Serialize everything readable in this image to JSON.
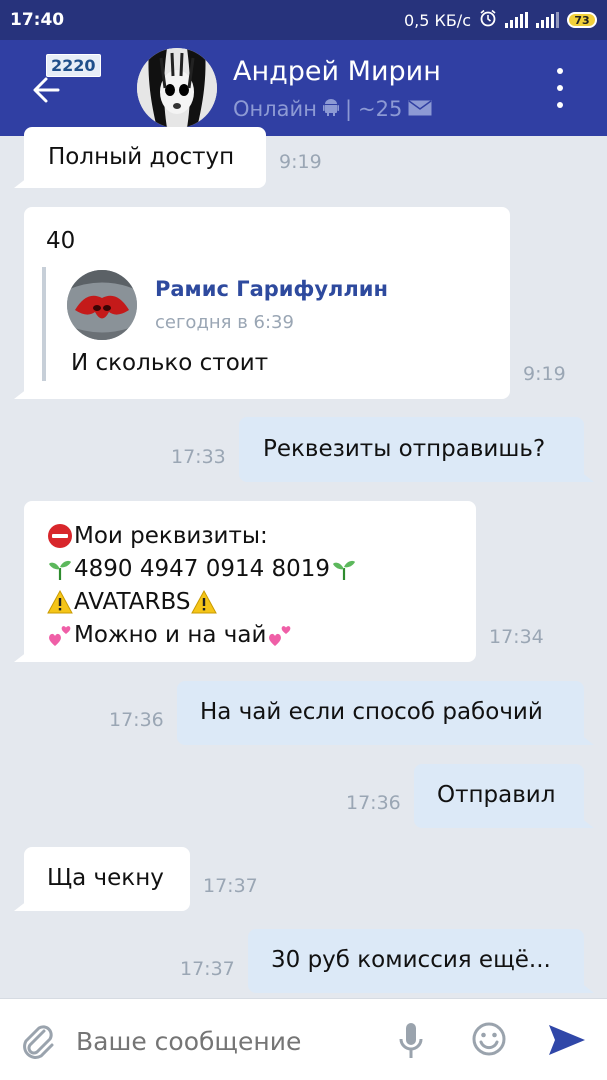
{
  "status_bar": {
    "time": "17:40",
    "net_speed": "0,5 КБ/с",
    "battery": "73"
  },
  "header": {
    "back_badge": "2220",
    "name": "Андрей Мирин",
    "status": "Онлайн",
    "separator": "|",
    "count": "~25"
  },
  "messages": {
    "m1": {
      "text": "Полный доступ",
      "time": "9:19"
    },
    "m2": {
      "text": "40",
      "quote_author": "Рамис Гарифуллин",
      "quote_date": "сегодня в 6:39",
      "quote_text": "И сколько стоит",
      "time": "9:19"
    },
    "m3": {
      "text": "Реквезиты отправишь?",
      "time": "17:33"
    },
    "m4": {
      "line1": "Мои реквизиты:",
      "line2": "4890 4947 0914 8019",
      "line3": "AVATARBS",
      "line4": "Можно и на чай",
      "time": "17:34"
    },
    "m5": {
      "text": "На чай если способ рабочий",
      "time": "17:36"
    },
    "m6": {
      "text": "Отправил",
      "time": "17:36"
    },
    "m7": {
      "text": "Ща чекну",
      "time": "17:37"
    },
    "m8": {
      "text": "30 руб комиссия ещё...",
      "time": "17:37"
    }
  },
  "composer": {
    "placeholder": "Ваше сообщение"
  },
  "colors": {
    "header": "#303fa3",
    "status_bar": "#27337c",
    "outgoing": "#dce9f7",
    "incoming": "#ffffff",
    "accent": "#3047a8"
  }
}
